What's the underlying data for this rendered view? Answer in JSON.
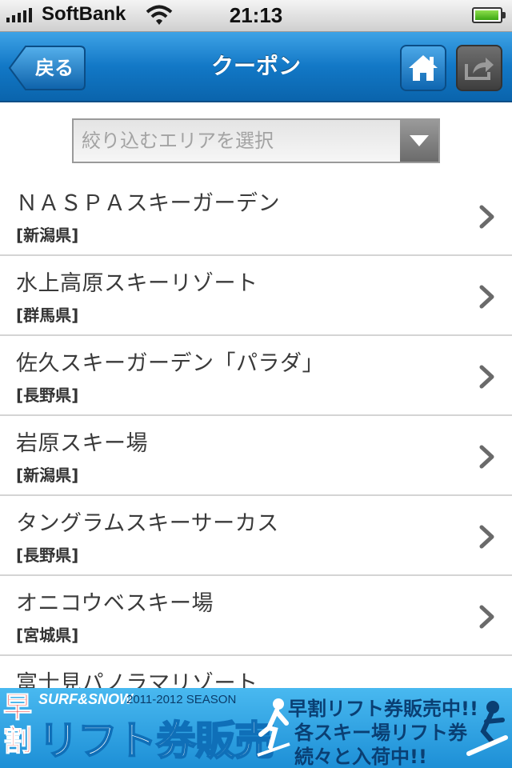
{
  "status_bar": {
    "carrier": "SoftBank",
    "time": "21:13",
    "battery_level": 0.95,
    "signal_bars": 5
  },
  "nav": {
    "back_label": "戻る",
    "title": "クーポン",
    "home_icon": "home-icon",
    "share_icon": "share-icon"
  },
  "area_select": {
    "placeholder": "絞り込むエリアを選択"
  },
  "resorts": [
    {
      "name": "ＮＡＳＰＡスキーガーデン",
      "prefecture": "[新潟県]"
    },
    {
      "name": "水上高原スキーリゾート",
      "prefecture": "[群馬県]"
    },
    {
      "name": "佐久スキーガーデン「パラダ」",
      "prefecture": "[長野県]"
    },
    {
      "name": "岩原スキー場",
      "prefecture": "[新潟県]"
    },
    {
      "name": "タングラムスキーサーカス",
      "prefecture": "[長野県]"
    },
    {
      "name": "オニコウベスキー場",
      "prefecture": "[宮城県]"
    },
    {
      "name": "富士見パノラマリゾート",
      "prefecture": ""
    }
  ],
  "ad": {
    "hayawari": "早割",
    "surf_snow": "SURF&SNOW",
    "season": "2011-2012 SEASON",
    "headline": "リフト券販売",
    "line1": "早割リフト券販売中!!",
    "line2": "各スキー場リフト券",
    "line3": "続々と入荷中!!"
  },
  "colors": {
    "nav_blue": "#1278c6",
    "banner_blue": "#2a9ee0",
    "separator": "#d4d4d4"
  }
}
